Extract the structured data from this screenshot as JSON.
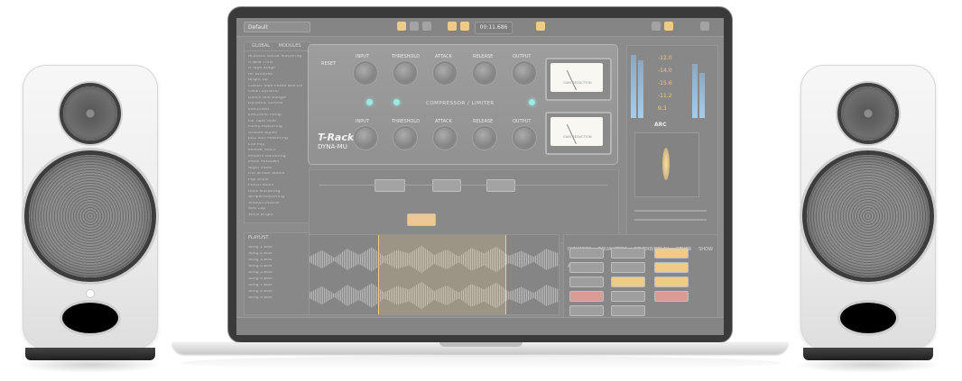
{
  "scene": {
    "alt_description": "Two white studio monitor speakers flanking a laptop running mastering software"
  },
  "screen": {
    "preset": "Default",
    "timer": "00:11.686",
    "sidebar_tabs": [
      "GLOBAL",
      "MODULES"
    ],
    "sidebar_items": [
      "Acoustic Guitar Mastering",
      "A New Thrill",
      "A Tape Stage",
      "Air Breather",
      "Bright Up",
      "Classic Vibe Mixed Bus Line",
      "Clean Dynamo",
      "Dance and Boogie",
      "Dynamic Control",
      "Electrified",
      "Electronic Pump",
      "Fat Tape Glue",
      "Funky Mastering",
      "Groove Styles",
      "Jazz Soft Mastering",
      "Lite Pop",
      "Mellow Touch",
      "Modern Mastering",
      "Mono Mixdown",
      "Night Vibes",
      "Old School Sound",
      "Pop Shine",
      "Punch Room",
      "Rock Mastering",
      "Simple Mastering",
      "Smooth Master",
      "Soft Clip",
      "Vocal Bright"
    ],
    "plugin": {
      "logo_line1": "T-RackS",
      "logo_line2": "DYNA-MU",
      "reset_label": "RESET",
      "top_labels": [
        "INPUT",
        "THRESHOLD",
        "ATTACK",
        "RELEASE",
        "OUTPUT"
      ],
      "bottom_labels": [
        "INPUT",
        "THRESHOLD",
        "ATTACK",
        "RELEASE",
        "OUTPUT"
      ],
      "mode_label": "COMPRESSOR / LIMITER",
      "meter_label": "GAIN REDUCTION"
    },
    "readouts": [
      "-12.0",
      "-14.0",
      "-15.6",
      "-11.2",
      "9.3"
    ],
    "brand": "ARC",
    "playlist_title": "PLAYLIST",
    "playlist_rows": [
      "Song 1.wav",
      "Song 2.wav",
      "Song 3.wav",
      "Song 4.wav",
      "Song 5.wav",
      "Song 6.wav",
      "Song 7.wav",
      "Song 8.wav",
      "Song 9.wav"
    ],
    "browser_tabs": [
      "DYNAMICS",
      "EQUALIZERS",
      "REVERB/DELAY",
      "OTHER",
      "SHOW ALL"
    ],
    "colors": {
      "accent": "#e0a020",
      "teal": "#45d8c8",
      "meter_blue": "#5aa2d9"
    }
  }
}
